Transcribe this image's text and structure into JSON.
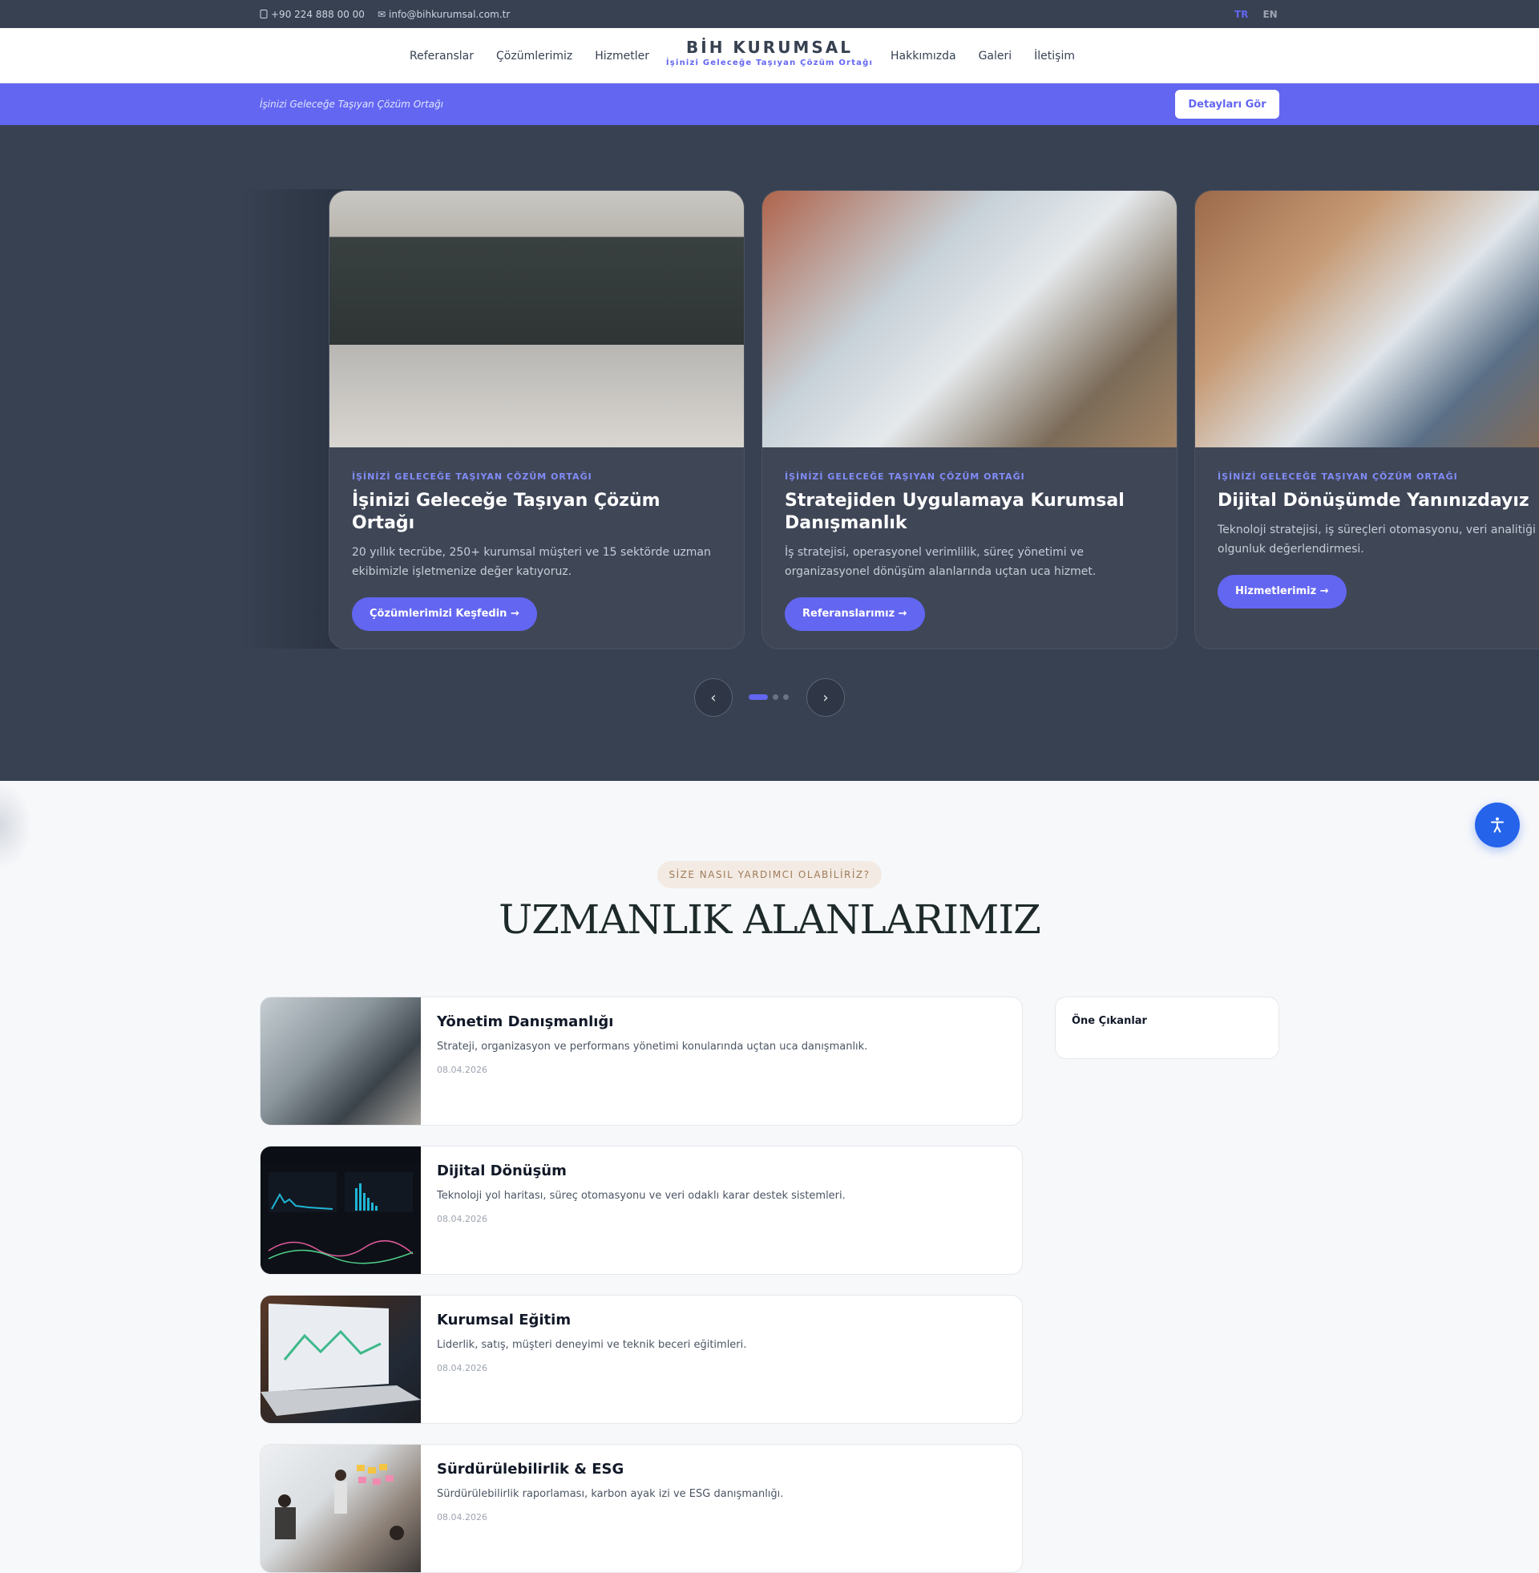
{
  "topbar": {
    "phone": "+90 224 888 00 00",
    "email": "info@bihkurumsal.com.tr",
    "lang_tr": "TR",
    "lang_en": "EN"
  },
  "header": {
    "brand": "BİH KURUMSAL",
    "tagline": "İşinizi Geleceğe Taşıyan Çözüm Ortağı",
    "nav_left": [
      "Referanslar",
      "Çözümlerimiz",
      "Hizmetler"
    ],
    "nav_right": [
      "Hakkımızda",
      "Galeri",
      "İletişim"
    ]
  },
  "announcement": {
    "text": "İşinizi Geleceğe Taşıyan Çözüm Ortağı",
    "button": "Detayları Gör"
  },
  "slider": {
    "slides": [
      {
        "eyebrow": "İŞİNİZİ GELECEĞE TAŞIYAN ÇÖZÜM ORTAĞI",
        "title": "İşinizi Geleceğe Taşıyan Çözüm Ortağı",
        "description": "20 yıllık tecrübe, 250+ kurumsal müşteri ve 15 sektörde uzman ekibimizle işletmenize değer katıyoruz.",
        "cta": "Çözümlerimizi Keşfedin →"
      },
      {
        "eyebrow": "İŞİNİZİ GELECEĞE TAŞIYAN ÇÖZÜM ORTAĞI",
        "title": "Stratejiden Uygulamaya Kurumsal Danışmanlık",
        "description": "İş stratejisi, operasyonel verimlilik, süreç yönetimi ve organizasyonel dönüşüm alanlarında uçtan uca hizmet.",
        "cta": "Referanslarımız →"
      },
      {
        "eyebrow": "İŞİNİZİ GELECEĞE TAŞIYAN ÇÖZÜM ORTAĞI",
        "title": "Dijital Dönüşümde Yanınızdayız",
        "description": "Teknoloji stratejisi, iş süreçleri otomasyonu, veri analitiği olgunluk değerlendirmesi.",
        "cta": "Hizmetlerimiz →"
      }
    ],
    "prev": "‹",
    "next": "›",
    "active_index": 0,
    "dot_count": 3
  },
  "section": {
    "pill": "SİZE NASIL YARDIMCI OLABİLİRİZ?",
    "title": "UZMANLIK ALANLARIMIZ"
  },
  "cards": [
    {
      "title": "Yönetim Danışmanlığı",
      "description": "Strateji, organizasyon ve performans yönetimi konularında uçtan uca danışmanlık.",
      "date": "08.04.2026"
    },
    {
      "title": "Dijital Dönüşüm",
      "description": "Teknoloji yol haritası, süreç otomasyonu ve veri odaklı karar destek sistemleri.",
      "date": "08.04.2026"
    },
    {
      "title": "Kurumsal Eğitim",
      "description": "Liderlik, satış, müşteri deneyimi ve teknik beceri eğitimleri.",
      "date": "08.04.2026"
    },
    {
      "title": "Sürdürülebilirlik & ESG",
      "description": "Sürdürülebilirlik raporlaması, karbon ayak izi ve ESG danışmanlığı.",
      "date": "08.04.2026"
    }
  ],
  "sidebar": {
    "title": "Öne Çıkanlar"
  },
  "colors": {
    "accent": "#6366f1",
    "dark": "#374151",
    "a11y": "#2563eb"
  }
}
